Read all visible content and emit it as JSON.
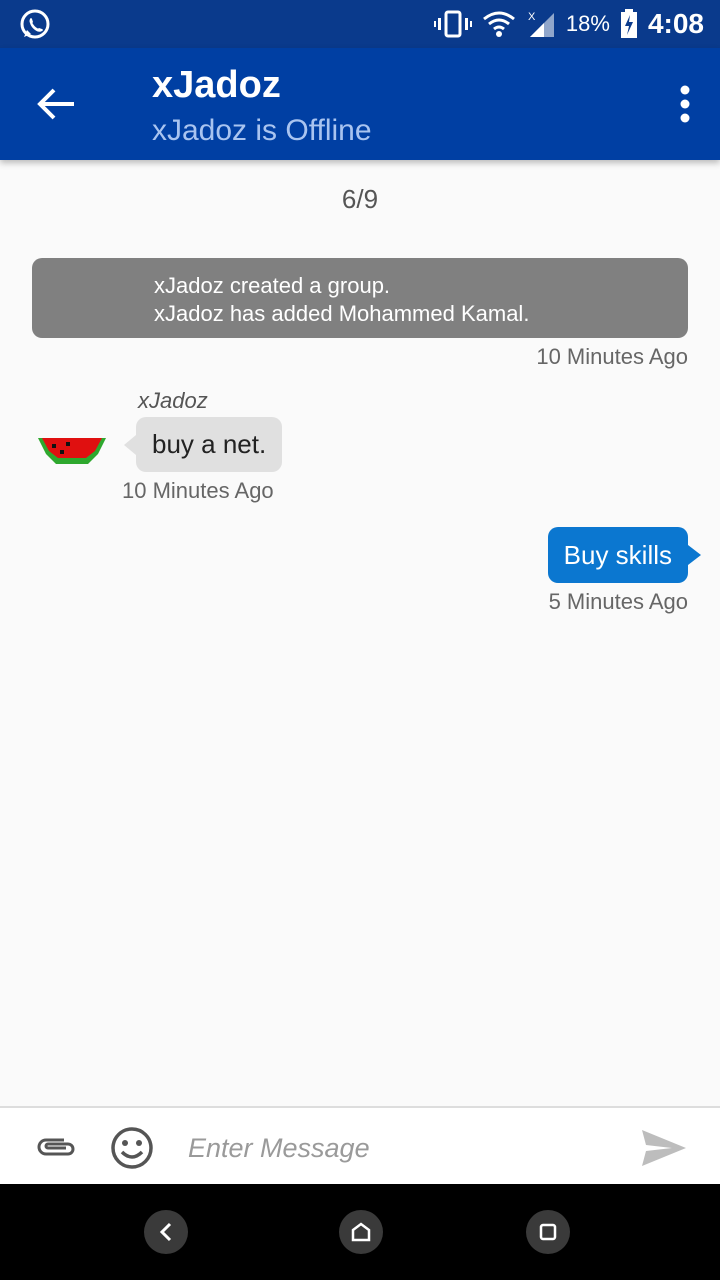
{
  "status_bar": {
    "battery_percent": "18%",
    "time": "4:08",
    "notification_icon": "whatsapp-icon"
  },
  "app_bar": {
    "title": "xJadoz",
    "subtitle": "xJadoz is Offline"
  },
  "chat": {
    "page_indicator": "6/9",
    "system_message": {
      "lines": [
        "xJadoz created a group.",
        "xJadoz has added Mohammed Kamal."
      ],
      "time": "10 Minutes Ago"
    },
    "incoming": {
      "sender": "xJadoz",
      "text": "buy a net.",
      "time": "10 Minutes Ago",
      "avatar": "watermelon-icon"
    },
    "outgoing": {
      "text": "Buy skills",
      "time": "5 Minutes Ago"
    }
  },
  "composer": {
    "placeholder": "Enter Message",
    "value": ""
  },
  "colors": {
    "status_bar": "#0a3a8c",
    "app_bar": "#003fa3",
    "outgoing_bubble": "#0b77d0",
    "incoming_bubble": "#e0e0e0",
    "system_message": "#808080"
  }
}
